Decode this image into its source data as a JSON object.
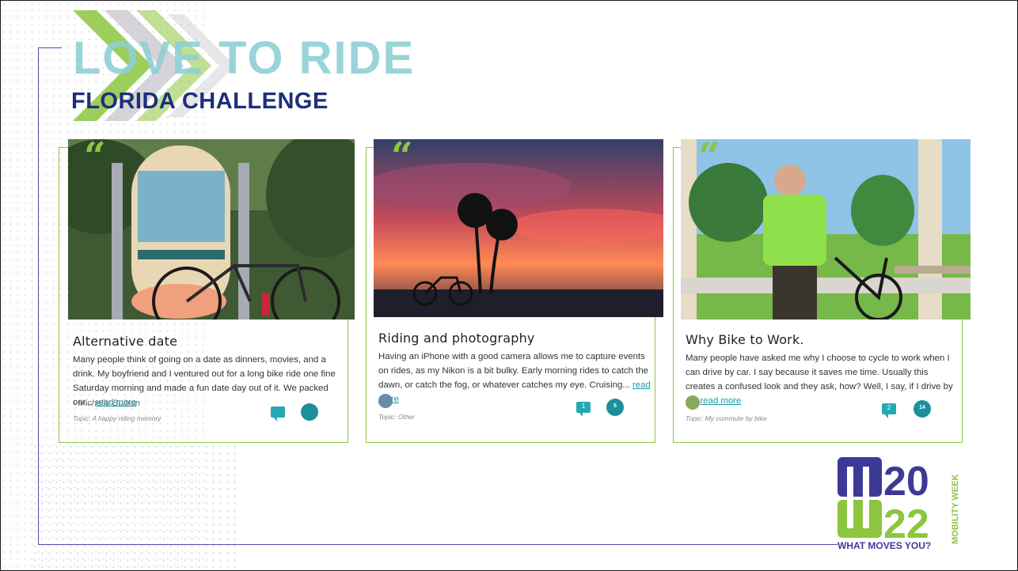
{
  "logo": {
    "title": "LOVE TO RIDE",
    "subtitle": "FLORIDA CHALLENGE"
  },
  "cards": [
    {
      "title": "Alternative date",
      "text": "Many people think of going on a date as dinners, movies, and a drink. My boyfriend and I ventured out for a long bike ride one fine Saturday morning and made a fun date day out of it. We packed our...",
      "read_more": "read more",
      "author": "- Michelle Buitron",
      "topic": "Topic: A happy riding memory",
      "comments": "",
      "hi5": ""
    },
    {
      "title": "Riding and photography",
      "text": "Having an iPhone with a good camera allows me to capture events on rides, as my Nikon is a bit bulky. Early morning rides to catch the dawn, or catch the fog, or whatever catches my eye. Cruising...",
      "read_more": "read more",
      "topic": "Topic: Other",
      "comments": "1",
      "hi5": "5"
    },
    {
      "title": "Why Bike to Work.",
      "text": "Many people have asked me why I choose to cycle to work when I can drive by car. I say because it saves me time. Usually this creates a confused look and they ask, how? Well, I say, if I drive by c...",
      "read_more": "read more",
      "topic": "Topic: My commute by bike",
      "comments": "2",
      "hi5": "14"
    }
  ],
  "mobility": {
    "year_top": "20",
    "year_bottom": "22",
    "side": "MOBILITY WEEK",
    "tagline": "WHAT MOVES YOU?"
  },
  "colors": {
    "green": "#8cc63f",
    "teal": "#24a9b5",
    "navy": "#1e2f7a",
    "purple": "#3d3a97"
  }
}
